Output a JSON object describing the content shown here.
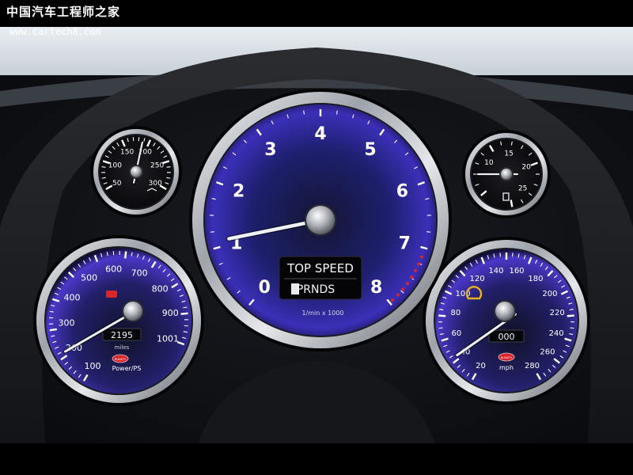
{
  "watermark": {
    "title": "中国汽车工程师之家",
    "url": "www.cartech8.com"
  },
  "tachometer": {
    "numbers": [
      "0",
      "1",
      "2",
      "3",
      "4",
      "5",
      "6",
      "7",
      "8"
    ],
    "display_top": "TOP SPEED",
    "display_gear": "PRNDS",
    "units": "1/min x 1000",
    "needle_value": 1.1
  },
  "power_gauge": {
    "numbers": [
      "100",
      "200",
      "300",
      "400",
      "500",
      "600",
      "700",
      "800",
      "900",
      "1001"
    ],
    "odometer": "2195",
    "odometer_unit": "miles",
    "brand": "BUGATTI",
    "label": "Power/PS"
  },
  "speedometer": {
    "numbers": [
      "20",
      "40",
      "60",
      "80",
      "100",
      "120",
      "140",
      "160",
      "180",
      "200",
      "220",
      "240",
      "260",
      "280"
    ],
    "trip": "000",
    "brand": "BUGATTI",
    "label": "mph"
  },
  "oil_temp_gauge": {
    "numbers": [
      "50",
      "100",
      "150",
      "200",
      "250",
      "300"
    ]
  },
  "fuel_gauge": {
    "numbers": [
      "10",
      "15",
      "20",
      "25"
    ]
  },
  "colors": {
    "dial_blue": "#3b2fb8",
    "warning_red": "#d8262b",
    "warning_amber": "#f1b21a",
    "tire_light": "#e8b318",
    "chrome": "#c9ccd2"
  }
}
